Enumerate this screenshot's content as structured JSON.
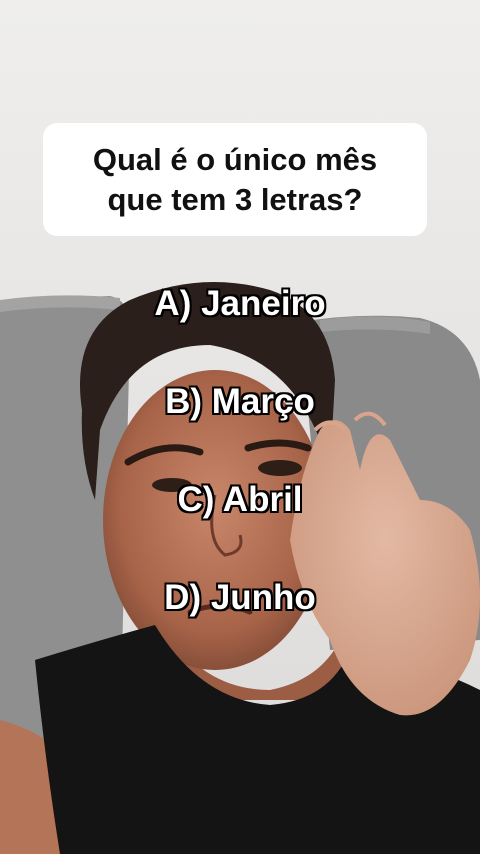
{
  "question": {
    "line1": "Qual é o único mês",
    "line2": "que tem 3 letras?"
  },
  "options": [
    {
      "label": "A) Janeiro"
    },
    {
      "label": "B) Março"
    },
    {
      "label": "C) Abril"
    },
    {
      "label": "D) Junho"
    }
  ]
}
